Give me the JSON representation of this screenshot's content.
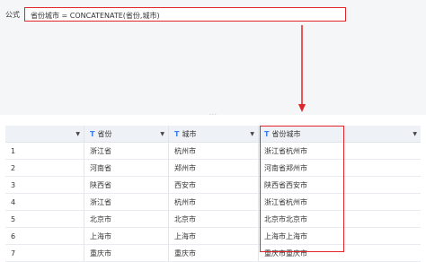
{
  "formula": {
    "label": "公式",
    "expression": "省份城市 = CONCATENATE(省份,城市)"
  },
  "colors": {
    "highlight": "#e0262b",
    "text_type_icon": "#3c7df0",
    "header_bg": "#eef1f6",
    "panel_bg": "#f5f6f8"
  },
  "table": {
    "columns": [
      {
        "label": "",
        "type_icon": "",
        "dropdown": "chevron-down-icon"
      },
      {
        "label": "省份",
        "type_icon": "T",
        "dropdown": "chevron-down-icon"
      },
      {
        "label": "城市",
        "type_icon": "T",
        "dropdown": "chevron-down-icon"
      },
      {
        "label": "省份城市",
        "type_icon": "T",
        "dropdown": "chevron-down-icon"
      }
    ],
    "rows": [
      {
        "n": "1",
        "province": "浙江省",
        "city": "杭州市",
        "combined": "浙江省杭州市"
      },
      {
        "n": "2",
        "province": "河南省",
        "city": "郑州市",
        "combined": "河南省郑州市"
      },
      {
        "n": "3",
        "province": "陕西省",
        "city": "西安市",
        "combined": "陕西省西安市"
      },
      {
        "n": "4",
        "province": "浙江省",
        "city": "杭州市",
        "combined": "浙江省杭州市"
      },
      {
        "n": "5",
        "province": "北京市",
        "city": "北京市",
        "combined": "北京市北京市"
      },
      {
        "n": "6",
        "province": "上海市",
        "city": "上海市",
        "combined": "上海市上海市"
      },
      {
        "n": "7",
        "province": "重庆市",
        "city": "重庆市",
        "combined": "重庆市重庆市"
      }
    ]
  }
}
